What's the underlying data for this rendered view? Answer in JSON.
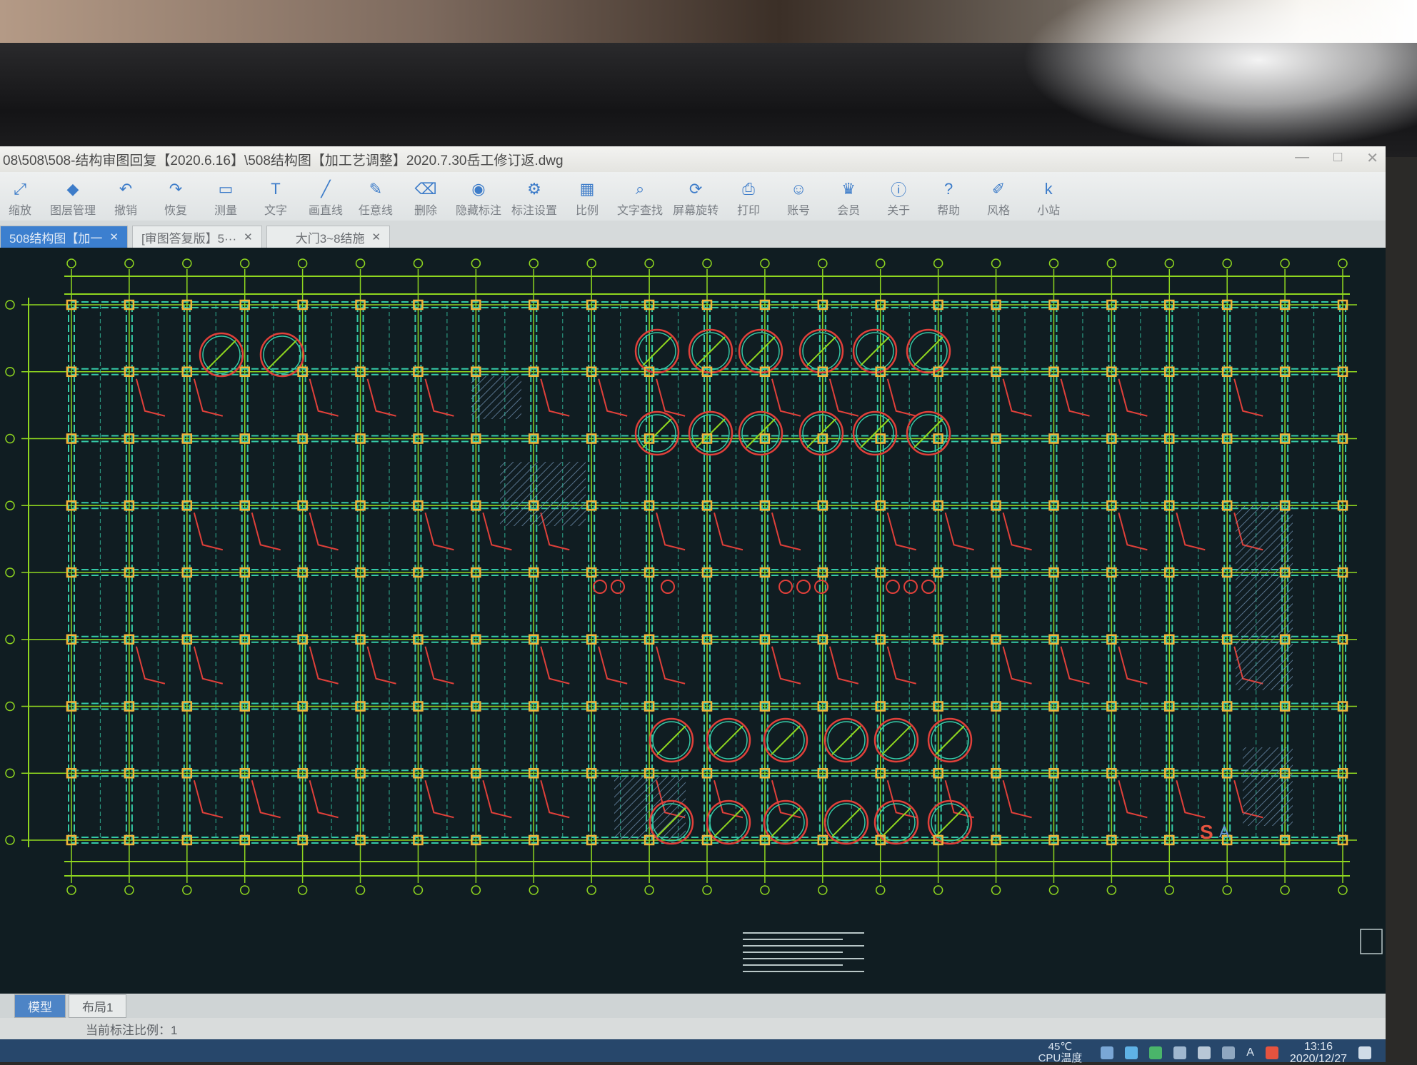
{
  "window": {
    "title": "08\\508\\508-结构审图回复【2020.6.16】\\508结构图【加工艺调整】2020.7.30岳工修订返.dwg",
    "controls": [
      "—",
      "□",
      "✕"
    ]
  },
  "toolbar": {
    "items": [
      {
        "label": "缩放",
        "icon": "zoom-icon",
        "glyph": "⤢"
      },
      {
        "label": "图层管理",
        "icon": "layers-icon",
        "glyph": "◆"
      },
      {
        "label": "撤销",
        "icon": "undo-icon",
        "glyph": "↶"
      },
      {
        "label": "恢复",
        "icon": "redo-icon",
        "glyph": "↷"
      },
      {
        "label": "测量",
        "icon": "measure-icon",
        "glyph": "▭"
      },
      {
        "label": "文字",
        "icon": "text-icon",
        "glyph": "T"
      },
      {
        "label": "画直线",
        "icon": "line-icon",
        "glyph": "╱"
      },
      {
        "label": "任意线",
        "icon": "pen-icon",
        "glyph": "✎"
      },
      {
        "label": "删除",
        "icon": "eraser-icon",
        "glyph": "⌫"
      },
      {
        "label": "隐藏标注",
        "icon": "eye-icon",
        "glyph": "◉"
      },
      {
        "label": "标注设置",
        "icon": "annotation-settings-icon",
        "glyph": "⚙"
      },
      {
        "label": "比例",
        "icon": "scale-icon",
        "glyph": "▦"
      },
      {
        "label": "文字查找",
        "icon": "find-text-icon",
        "glyph": "⌕"
      },
      {
        "label": "屏幕旋转",
        "icon": "rotate-screen-icon",
        "glyph": "⟳"
      },
      {
        "label": "打印",
        "icon": "print-icon",
        "glyph": "⎙"
      },
      {
        "label": "账号",
        "icon": "account-icon",
        "glyph": "☺"
      },
      {
        "label": "会员",
        "icon": "vip-icon",
        "glyph": "♛"
      },
      {
        "label": "关于",
        "icon": "about-icon",
        "glyph": "ⓘ"
      },
      {
        "label": "帮助",
        "icon": "help-icon",
        "glyph": "?"
      },
      {
        "label": "风格",
        "icon": "style-icon",
        "glyph": "✐"
      },
      {
        "label": "小站",
        "icon": "station-icon",
        "glyph": "k"
      }
    ]
  },
  "tabs": [
    {
      "label": "508结构图【加一",
      "close": "✕",
      "active": true
    },
    {
      "label": "[审图答复版】5···",
      "close": "✕",
      "active": false
    },
    {
      "label": "大门3~8结施",
      "close": "✕",
      "active": false
    }
  ],
  "layout_tabs": [
    "模型",
    "布局1"
  ],
  "status": {
    "scale_text": "当前标注比例：1"
  },
  "taskbar": {
    "cpu_temp": "45℃",
    "cpu_label": "CPU温度",
    "time": "13:16",
    "date": "2020/12/27",
    "ime_letter": "A"
  },
  "colors": {
    "drawing_bg": "#101d22",
    "beam": "#35c9a6",
    "gridline": "#8fd61f",
    "column": "#f2b33a",
    "rebar": "#e0403a",
    "accent": "#3c7fcf"
  }
}
